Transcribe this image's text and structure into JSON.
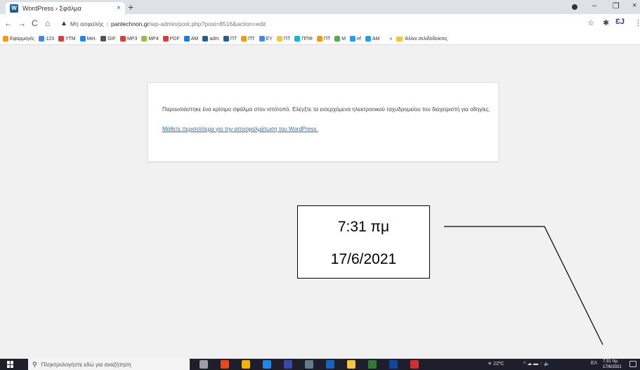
{
  "browser": {
    "tab_title": "WordPress › Σφάλμα",
    "tab_favicon": "W",
    "tab_close": "×",
    "new_tab": "+",
    "window_minimize": "–",
    "window_restore": "❐",
    "window_close": "×",
    "nav_back": "←",
    "nav_forward": "→",
    "nav_reload": "C",
    "nav_home": "⌂",
    "security_warning": "▲",
    "security_label": "Μη ασφαλής",
    "url_domain": "pantechnon.gr",
    "url_path": "/wp-admin/post.php?post=8516&action=edit",
    "star": "☆",
    "extensions": "✱",
    "profile": "ƐJ",
    "menu": "⋮"
  },
  "bookmarks": {
    "items": [
      {
        "label": "Εφαρμογές",
        "color": "#ff9800"
      },
      {
        "label": "123",
        "color": "#4285f4"
      },
      {
        "label": "YTM",
        "color": "#e53935"
      },
      {
        "label": "Met.",
        "color": "#1e88e5"
      },
      {
        "label": "GIF",
        "color": "#555555"
      },
      {
        "label": "MP3",
        "color": "#e53935"
      },
      {
        "label": "MP4",
        "color": "#8bc34a"
      },
      {
        "label": "PDF",
        "color": "#e53935"
      },
      {
        "label": "AM",
        "color": "#1877f2"
      },
      {
        "label": "adm",
        "color": "#1e5f99"
      },
      {
        "label": "ΠΤ",
        "color": "#1e5f99"
      },
      {
        "label": "ΠΤ",
        "color": "#ff9800"
      },
      {
        "label": "EY",
        "color": "#4285f4"
      },
      {
        "label": "ΠΤ",
        "color": "#f5c542"
      },
      {
        "label": "ΠΠΦ",
        "color": "#00bcd4"
      },
      {
        "label": "ΠΤ",
        "color": "#ff9800"
      },
      {
        "label": "M",
        "color": "#4caf50"
      },
      {
        "label": "ef",
        "color": "#1da1f2"
      },
      {
        "label": "AM",
        "color": "#1da1f2"
      }
    ],
    "more": "»",
    "other": "Άλλοι σελιδοδείκτες"
  },
  "error": {
    "message": "Παρουσιάστηκε ένα κρίσιμο σφάλμα στον ιστότοπό. Ελέγξτε τα εισερχόμενα ηλεκτρονικού ταχυδρομείου του διαχειριστή για οδηγίες.",
    "link": "Μάθετε περισσότερα για την αποσφαλμάτωση του WordPress."
  },
  "callout": {
    "time": "7:31 πμ",
    "date": "17/6/2021"
  },
  "taskbar": {
    "search_placeholder": "Πληκτρολογήστε εδώ για αναζήτηση",
    "weather": "22ºC",
    "language": "ΕΛ",
    "clock_time": "7:31 πμ",
    "clock_date": "17/6/2021",
    "apps": [
      {
        "name": "task-view",
        "color": "#9aa0a6"
      },
      {
        "name": "app-paint",
        "color": "#e64a19"
      },
      {
        "name": "app-chrome",
        "color": "#f4b400"
      },
      {
        "name": "app-edge",
        "color": "#1e88e5"
      },
      {
        "name": "app-browser",
        "color": "#3949ab"
      },
      {
        "name": "app-calculator",
        "color": "#607d8b"
      },
      {
        "name": "app-word",
        "color": "#1565c0"
      },
      {
        "name": "app-explorer",
        "color": "#f5c542"
      },
      {
        "name": "app-excel",
        "color": "#2e7d32"
      },
      {
        "name": "app-outlook",
        "color": "#0d47a1"
      },
      {
        "name": "app-acrobat",
        "color": "#d32f2f"
      }
    ]
  }
}
